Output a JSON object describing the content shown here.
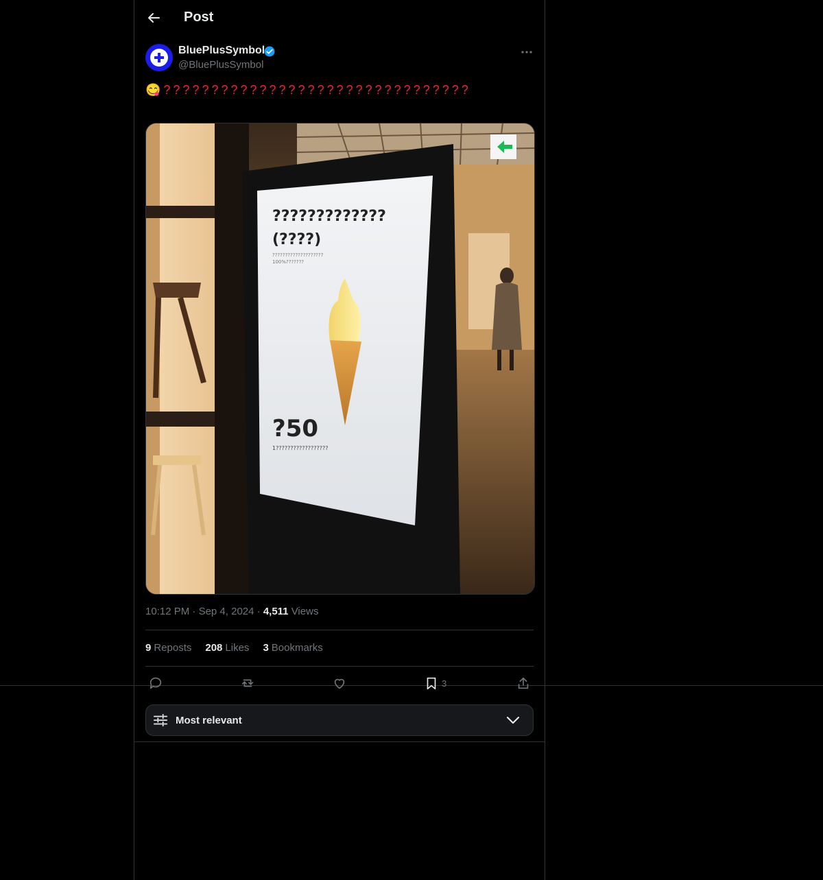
{
  "header": {
    "title": "Post",
    "back_icon": "arrow-left-icon"
  },
  "author": {
    "name": "BluePlusSymbol",
    "handle": "@BluePlusSymbol",
    "verified": true,
    "avatar_color": "#1d1de8"
  },
  "post": {
    "text": "😋????????????????????????????????",
    "media": {
      "sign_heading": "?????????????",
      "sign_subheading": "(????)",
      "sign_small_1": "????????????????????",
      "sign_small_2": "100%???????",
      "sign_price": "?50",
      "sign_footer": "1??????????????????"
    },
    "time": "10:12 PM",
    "date": "Sep 4, 2024",
    "views_count": "4,511",
    "views_label": "Views"
  },
  "stats": {
    "reposts_count": "9",
    "reposts_label": "Reposts",
    "likes_count": "208",
    "likes_label": "Likes",
    "bookmarks_count": "3",
    "bookmarks_label": "Bookmarks"
  },
  "actions": {
    "bookmark_count": "3"
  },
  "replies_sort": {
    "label": "Most relevant"
  },
  "colors": {
    "background": "#000000",
    "border": "#2f3336",
    "muted": "#71767b",
    "text": "#e7e9ea",
    "question_mark": "#f4212e",
    "verified": "#1d9bf0"
  }
}
